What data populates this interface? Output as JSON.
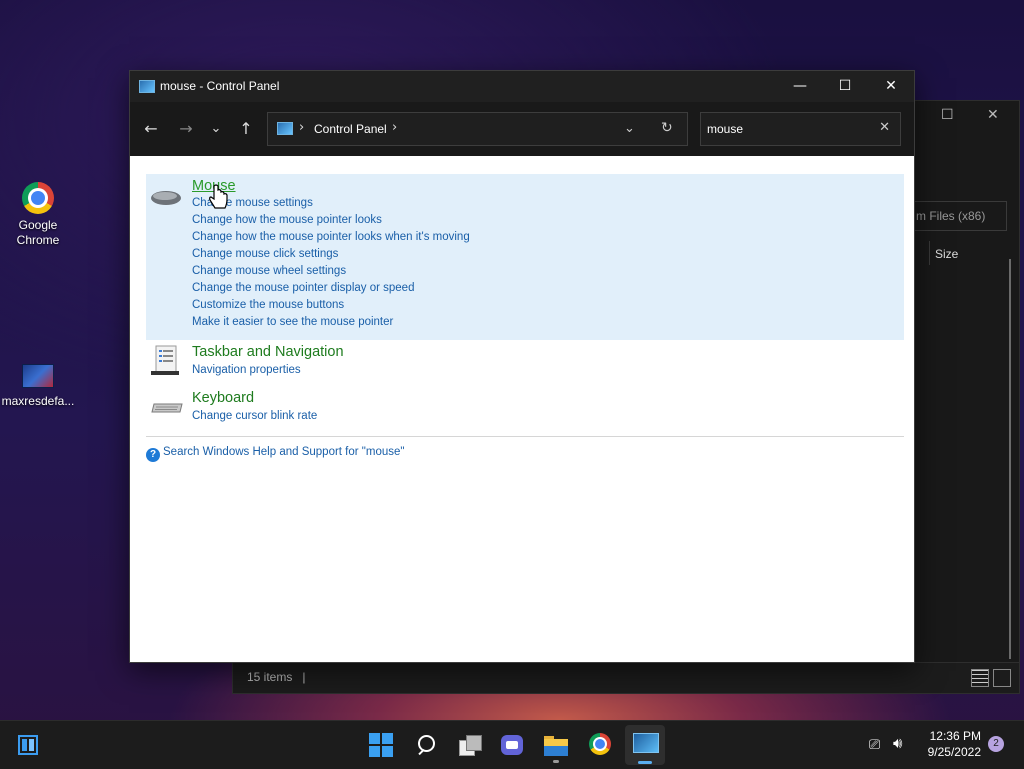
{
  "desktop": {
    "icons": [
      {
        "label": "Google\nChrome",
        "line1": "Google",
        "line2": "Chrome",
        "icon": "chrome-icon"
      },
      {
        "label": "maxresdefa...",
        "icon": "image-thumbnail-icon"
      }
    ]
  },
  "background_window": {
    "column_header_partial": "m Files (x86)",
    "column_size": "Size",
    "status_items": "15 items",
    "status_divider": "|"
  },
  "window": {
    "title": "mouse - Control Panel",
    "controls": {
      "minimize": "—",
      "maximize": "☐",
      "close": "✕"
    },
    "nav": {
      "back": "←",
      "forward": "→",
      "recent": "⌄",
      "up": "↑"
    },
    "address": {
      "separator1": "›",
      "crumb": "Control Panel",
      "separator2": "›",
      "dropdown": "⌄",
      "refresh": "↻"
    },
    "search": {
      "value": "mouse",
      "clear": "✕"
    }
  },
  "results": [
    {
      "title": "Mouse",
      "icon": "mouse-icon",
      "links": [
        "Change mouse settings",
        "Change how the mouse pointer looks",
        "Change how the mouse pointer looks when it's moving",
        "Change mouse click settings",
        "Change mouse wheel settings",
        "Change the mouse pointer display or speed",
        "Customize the mouse buttons",
        "Make it easier to see the mouse pointer"
      ]
    },
    {
      "title": "Taskbar and Navigation",
      "icon": "taskbar-icon",
      "links": [
        "Navigation properties"
      ]
    },
    {
      "title": "Keyboard",
      "icon": "keyboard-icon",
      "links": [
        "Change cursor blink rate"
      ]
    }
  ],
  "help_link": "Search Windows Help and Support for \"mouse\"",
  "taskbar": {
    "apps": [
      "start-icon",
      "search-icon",
      "task-view-icon",
      "chat-icon",
      "file-explorer-icon",
      "chrome-icon",
      "control-panel-icon"
    ],
    "time": "12:36 PM",
    "date": "9/25/2022",
    "notification_count": "2"
  }
}
